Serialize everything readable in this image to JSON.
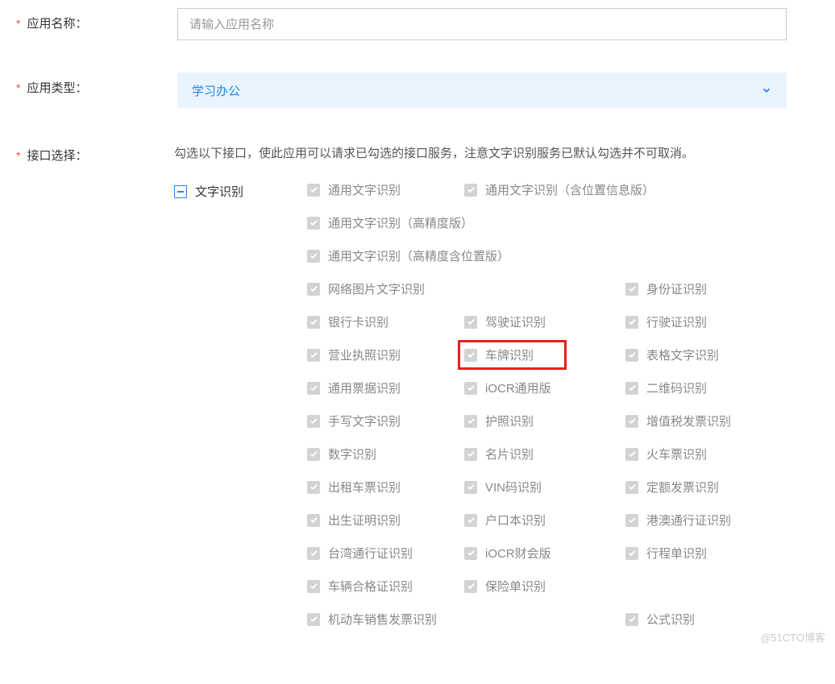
{
  "fields": {
    "appName": {
      "label": "应用名称：",
      "placeholder": "请输入应用名称"
    },
    "appType": {
      "label": "应用类型：",
      "value": "学习办公"
    },
    "apiSelect": {
      "label": "接口选择：",
      "description": "勾选以下接口，使此应用可以请求已勾选的接口服务，注意文字识别服务已默认勾选并不可取消。",
      "category": "文字识别"
    }
  },
  "apis": {
    "r0c0": "通用文字识别",
    "r0c1": "通用文字识别（含位置信息版）",
    "r1c0": "通用文字识别（高精度版）",
    "r2c0": "通用文字识别（高精度含位置版）",
    "r3c0": "网络图片文字识别",
    "r3c2": "身份证识别",
    "r4c0": "银行卡识别",
    "r4c1": "驾驶证识别",
    "r4c2": "行驶证识别",
    "r5c0": "营业执照识别",
    "r5c1": "车牌识别",
    "r5c2": "表格文字识别",
    "r6c0": "通用票据识别",
    "r6c1": "iOCR通用版",
    "r6c2": "二维码识别",
    "r7c0": "手写文字识别",
    "r7c1": "护照识别",
    "r7c2": "增值税发票识别",
    "r8c0": "数字识别",
    "r8c1": "名片识别",
    "r8c2": "火车票识别",
    "r9c0": "出租车票识别",
    "r9c1": "VIN码识别",
    "r9c2": "定额发票识别",
    "r10c0": "出生证明识别",
    "r10c1": "户口本识别",
    "r10c2": "港澳通行证识别",
    "r11c0": "台湾通行证识别",
    "r11c1": "iOCR财会版",
    "r11c2": "行程单识别",
    "r12c0": "车辆合格证识别",
    "r12c1": "保险单识别",
    "r13c0": "机动车销售发票识别",
    "r13c2": "公式识别"
  },
  "watermark": "@51CTO博客"
}
